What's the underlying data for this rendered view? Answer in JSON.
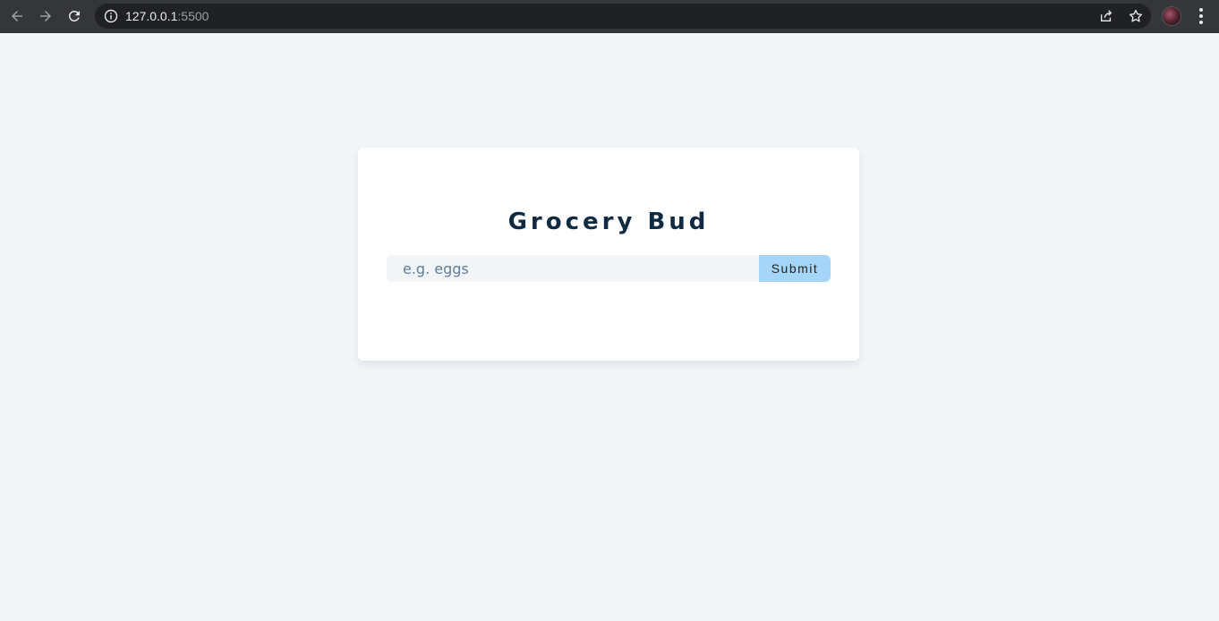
{
  "browser": {
    "url_host": "127.0.0.1",
    "url_port": ":5500",
    "icons": [
      "back-arrow-icon",
      "forward-arrow-icon",
      "reload-icon",
      "info-icon",
      "share-icon",
      "bookmark-star-icon",
      "profile-avatar",
      "more-menu-icon"
    ]
  },
  "app": {
    "title": "Grocery Bud",
    "input_placeholder": "e.g. eggs",
    "input_value": "",
    "submit_label": "Submit"
  },
  "colors": {
    "page_bg": "#f1f5f8",
    "card_bg": "#ffffff",
    "title": "#102a42",
    "submit_bg": "#a5d5f8",
    "placeholder": "#617d98"
  }
}
